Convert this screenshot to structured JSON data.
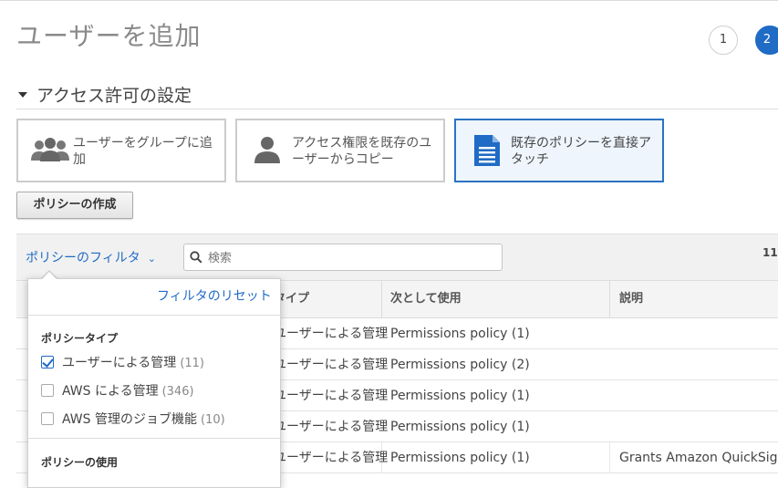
{
  "page": {
    "title": "ユーザーを追加"
  },
  "steps": [
    "1",
    "2"
  ],
  "section": {
    "title": "アクセス許可の設定"
  },
  "permission_options": [
    {
      "label": "ユーザーをグループに追加",
      "icon": "group-icon",
      "selected": false
    },
    {
      "label": "アクセス権限を既存のユーザーからコピー",
      "icon": "user-icon",
      "selected": false
    },
    {
      "label": "既存のポリシーを直接アタッチ",
      "icon": "document-icon",
      "selected": true
    }
  ],
  "create_policy_button": "ポリシーの作成",
  "toolbar": {
    "filter_label": "ポリシーのフィルタ",
    "search_placeholder": "検索",
    "count": "11"
  },
  "table": {
    "columns": [
      "タイプ",
      "次として使用",
      "説明"
    ],
    "rows": [
      {
        "type": "ユーザーによる管理",
        "used_as": "Permissions policy (1)",
        "description": ""
      },
      {
        "type": "ユーザーによる管理",
        "used_as": "Permissions policy (2)",
        "description": ""
      },
      {
        "type": "ユーザーによる管理",
        "used_as": "Permissions policy (1)",
        "description": ""
      },
      {
        "type": "ユーザーによる管理",
        "used_as": "Permissions policy (1)",
        "description": ""
      },
      {
        "type": "ユーザーによる管理",
        "used_as": "Permissions policy (1)",
        "description": "Grants Amazon QuickSight l"
      }
    ]
  },
  "filter_dropdown": {
    "reset_label": "フィルタのリセット",
    "policy_type_heading": "ポリシータイプ",
    "policy_types": [
      {
        "label": "ユーザーによる管理",
        "count": "(11)",
        "checked": true
      },
      {
        "label": "AWS による管理",
        "count": "(346)",
        "checked": false
      },
      {
        "label": "AWS 管理のジョブ機能",
        "count": "(10)",
        "checked": false
      }
    ],
    "policy_usage_heading": "ポリシーの使用"
  },
  "colors": {
    "accent": "#1f6bc5",
    "selected_bg": "#eef5fd"
  }
}
